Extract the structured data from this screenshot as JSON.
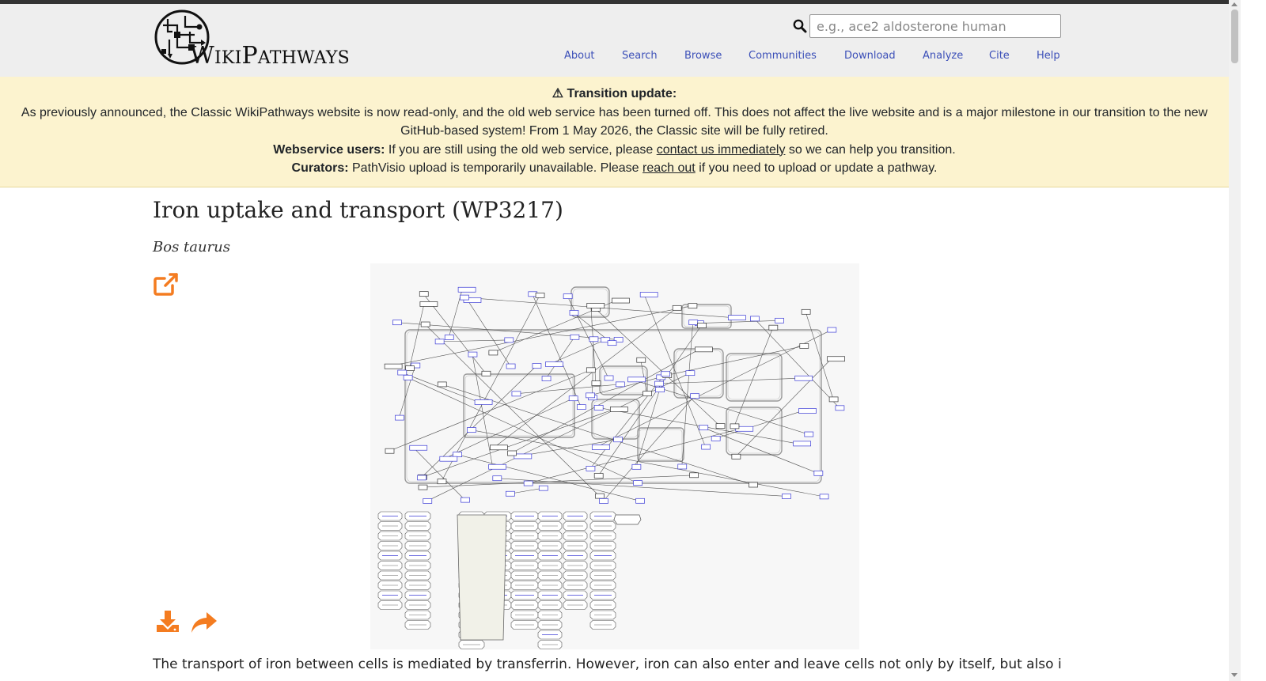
{
  "header": {
    "logo_text_initial": "W",
    "logo_text_rest": "IKI",
    "logo_text_initial2": "P",
    "logo_text_rest2": "ATHWAYS",
    "logo_alt": "WikiPathways",
    "search": {
      "placeholder": "e.g., ace2 aldosterone human",
      "value": ""
    },
    "nav": [
      "About",
      "Search",
      "Browse",
      "Communities",
      "Download",
      "Analyze",
      "Cite",
      "Help"
    ]
  },
  "banner": {
    "title": "⚠ Transition update:",
    "line1": "As previously announced, the Classic WikiPathways website is now read-only, and the old web service has been turned off. This does not affect the live website and is a major milestone in our transition to the new",
    "line2": "GitHub-based system! From 1 May 2026, the Classic site will be fully retired.",
    "webservice_label": "Webservice users:",
    "webservice_text_before": " If you are still using the old web service, please ",
    "webservice_link": "contact us immediately",
    "webservice_text_after": " so we can help you transition.",
    "curators_label": "Curators:",
    "curators_text_before": " PathVisio upload is temporarily unavailable. Please ",
    "curators_link": "reach out",
    "curators_text_after": " if you need to upload or update a pathway."
  },
  "page": {
    "title": "Iron uptake and transport (WP3217)",
    "species": "Bos taurus",
    "description": "The transport of iron between cells is mediated by transferrin. However, iron can also enter and leave cells not only by itself, but also in the form of"
  },
  "colors": {
    "accent": "#f47c20",
    "nav_link": "#3b4fb8",
    "banner_bg": "#fcf3cf",
    "header_bg": "#eeeeee",
    "node_stroke": "#3b3bd6"
  },
  "icons": {
    "search": "search-icon",
    "external": "external-link-icon",
    "download": "download-icon",
    "share": "share-icon"
  }
}
